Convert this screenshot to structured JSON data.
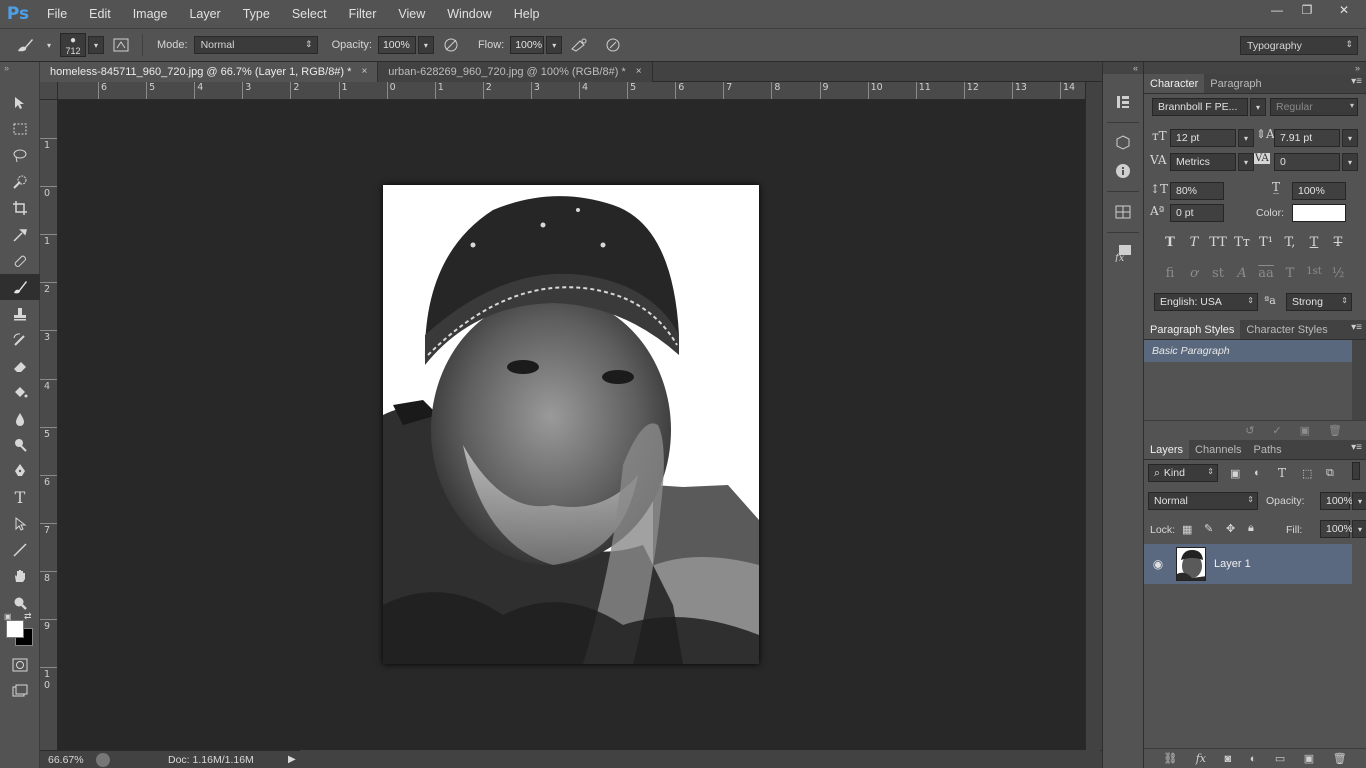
{
  "app": {
    "logo": "Ps"
  },
  "menu": [
    "File",
    "Edit",
    "Image",
    "Layer",
    "Type",
    "Select",
    "Filter",
    "View",
    "Window",
    "Help"
  ],
  "window_controls": {
    "minimize": "—",
    "restore": "❐",
    "close": "✕"
  },
  "options": {
    "brush_size": "712",
    "mode_label": "Mode:",
    "mode_value": "Normal",
    "opacity_label": "Opacity:",
    "opacity_value": "100%",
    "flow_label": "Flow:",
    "flow_value": "100%",
    "workspace": "Typography"
  },
  "tabs": [
    {
      "label": "homeless-845711_960_720.jpg @ 66.7% (Layer 1, RGB/8#) *",
      "close": "×",
      "active": true
    },
    {
      "label": "urban-628269_960_720.jpg @ 100% (RGB/8#) *",
      "close": "×",
      "active": false
    }
  ],
  "ruler_h": [
    "6",
    "5",
    "4",
    "3",
    "2",
    "1",
    "0",
    "1",
    "2",
    "3",
    "4",
    "5",
    "6",
    "7",
    "8",
    "9",
    "10",
    "11",
    "12",
    "13",
    "14"
  ],
  "ruler_v": [
    "1",
    "0",
    "1",
    "2",
    "3",
    "4",
    "5",
    "6",
    "7",
    "8",
    "9",
    "1 0"
  ],
  "status": {
    "zoom": "66.67%",
    "doc": "Doc: 1.16M/1.16M"
  },
  "character": {
    "tabs": [
      "Character",
      "Paragraph"
    ],
    "font_family": "Brannboll F PE...",
    "font_style": "Regular",
    "size": "12 pt",
    "leading": "7.91 pt",
    "kerning": "Metrics",
    "tracking": "0",
    "vscale": "80%",
    "hscale": "100%",
    "baseline": "0 pt",
    "color_label": "Color:",
    "color_value": "#ffffff",
    "language": "English: USA",
    "aa_icon": "ªa",
    "antialias": "Strong",
    "style_glyphs": [
      "T",
      "T",
      "TT",
      "Tт",
      "T¹",
      "T,",
      "T",
      "T"
    ],
    "opentype_glyphs": [
      "fi",
      "ơ",
      "st",
      "A",
      "aa",
      "T",
      "1st",
      "½"
    ]
  },
  "paragraph_styles": {
    "tabs": [
      "Paragraph Styles",
      "Character Styles"
    ],
    "items": [
      "Basic Paragraph"
    ]
  },
  "layers": {
    "tabs": [
      "Layers",
      "Channels",
      "Paths"
    ],
    "filter_kind": "Kind",
    "blend_mode": "Normal",
    "opacity_label": "Opacity:",
    "opacity_value": "100%",
    "lock_label": "Lock:",
    "fill_label": "Fill:",
    "fill_value": "100%",
    "items": [
      {
        "name": "Layer 1",
        "visible": true
      }
    ]
  }
}
